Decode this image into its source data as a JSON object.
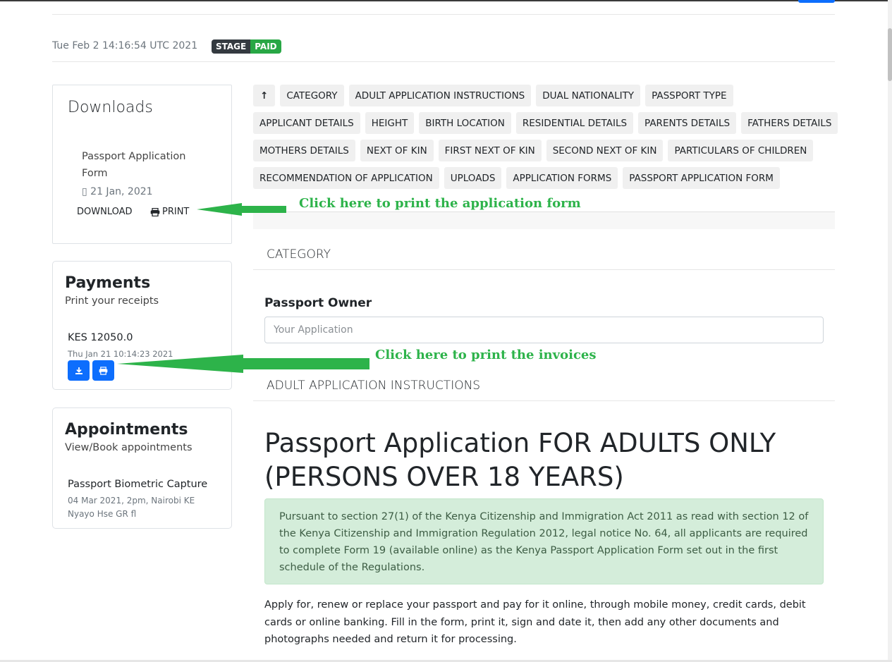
{
  "header": {
    "date": "Tue Feb 2 14:16:54 UTC 2021",
    "stage_label": "STAGE",
    "status_label": "PAID"
  },
  "downloads": {
    "title": "Downloads",
    "item_name": "Passport Application Form",
    "item_date": "21 Jan, 2021",
    "download_label": "DOWNLOAD",
    "print_label": "PRINT"
  },
  "payments": {
    "title": "Payments",
    "subtitle": "Print your receipts",
    "amount": "KES 12050.0",
    "date": "Thu Jan 21 10:14:23 2021"
  },
  "appointments": {
    "title": "Appointments",
    "subtitle": "View/Book appointments",
    "name": "Passport Biometric Capture",
    "detail": "04 Mar 2021, 2pm, Nairobi KE Nyayo Hse GR fl"
  },
  "nav": {
    "rows": [
      [
        "↑",
        "CATEGORY",
        "ADULT APPLICATION INSTRUCTIONS",
        "DUAL NATIONALITY",
        "PASSPORT TYPE"
      ],
      [
        "APPLICANT DETAILS",
        "HEIGHT",
        "BIRTH LOCATION",
        "RESIDENTIAL DETAILS",
        "PARENTS DETAILS",
        "FATHERS DETAILS"
      ],
      [
        "MOTHERS DETAILS",
        "NEXT OF KIN",
        "FIRST NEXT OF KIN",
        "SECOND NEXT OF KIN",
        "PARTICULARS OF CHILDREN"
      ],
      [
        "RECOMMENDATION OF APPLICATION",
        "UPLOADS",
        "APPLICATION FORMS",
        "PASSPORT APPLICATION FORM"
      ]
    ]
  },
  "main": {
    "category_heading": "CATEGORY",
    "owner_label": "Passport Owner",
    "owner_placeholder": "Your Application",
    "instructions_heading": "ADULT APPLICATION INSTRUCTIONS",
    "title": "Passport Application FOR ADULTS ONLY (PERSONS OVER 18 YEARS)",
    "alert": "Pursuant to section 27(1) of the Kenya Citizenship and Immigration Act 2011 as read with section 12 of the Kenya Citizenship and Immigration Regulation 2012, legal notice No. 64, all applicants are required to complete Form 19 (available online) as the Kenya Passport Application Form set out in the first schedule of the Regulations.",
    "paragraph": "Apply for, renew or replace your passport and pay for it online, through mobile money, credit cards, debit cards or online banking. Fill in the form, print it, sign and date it, then add any other documents and photographs needed and return it for processing."
  },
  "annotations": {
    "print_form": "Click here to print the application form",
    "print_invoices": "Click here to print the invoices"
  },
  "colors": {
    "annotation_green": "#2db34a",
    "primary_blue": "#0d6efd",
    "paid_green": "#28a745",
    "stage_dark": "#343a40",
    "alert_bg": "#d4edda"
  }
}
